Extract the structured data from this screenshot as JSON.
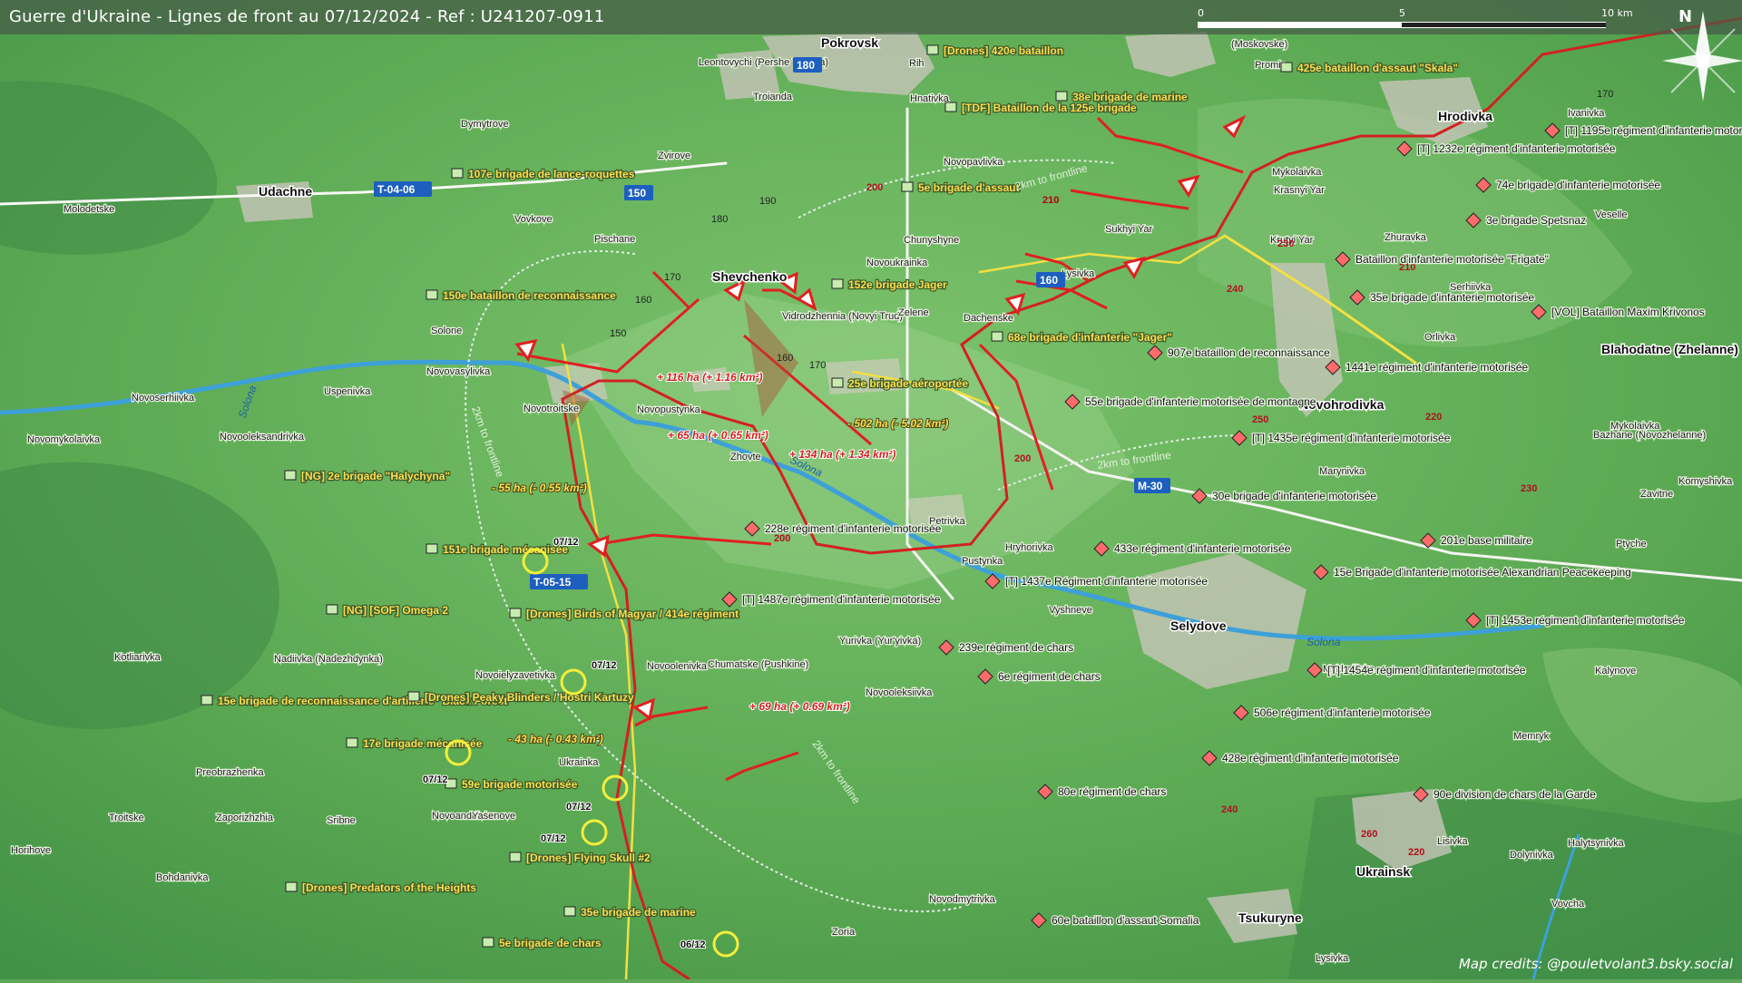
{
  "title": "Guerre d'Ukraine - Lignes de front au 07/12/2024 - Ref : U241207-0911",
  "credits": "Map credits: @pouletvolant3.bsky.social",
  "compass_label": "N",
  "scale": {
    "labels": [
      "0",
      "5",
      "10 km"
    ]
  },
  "colors": {
    "front_line": "#d32020",
    "advance_arrow": "#e02020",
    "unit_text": "#ffde50",
    "enemy_unit": "#ff6b6b",
    "road": "#f4e040"
  },
  "towns": [
    {
      "name": "Pokrovsk"
    },
    {
      "name": "Shevchenko"
    },
    {
      "name": "Udachne"
    },
    {
      "name": "Selydove"
    },
    {
      "name": "Novohrodivka"
    },
    {
      "name": "Hrodivka"
    },
    {
      "name": "Ukrainsk"
    },
    {
      "name": "Tsukuryne"
    },
    {
      "name": "Blahodatne (Zhelanne)"
    }
  ],
  "villages": [
    "Leontovychi (Pershe Travnia)",
    "Troianda",
    "Zvirove",
    "Dymytrove",
    "Molodetske",
    "Pischane",
    "Vovkove",
    "Solone",
    "Novovasylivka",
    "Uspenivka",
    "Novoserhiivka",
    "Novomykolaivka",
    "Novooleksandrivka",
    "Novotroitske",
    "Novopustynka",
    "Zhovte",
    "Vidrodzhennia (Novyi Trud)",
    "Zelene",
    "Dachenske",
    "Novoukrainka",
    "Chunyshyne",
    "Novopavlivka",
    "Hnativka",
    "Rih",
    "Sukhyi Yar",
    "Lysivka",
    "Krutyi Yar",
    "Zhuravka",
    "Mykolaivka",
    "Krasnyi Yar",
    "Promin",
    "(Moskovske)",
    "Ivanivka",
    "Veselle",
    "Serhiivka",
    "Orlivka",
    "Mykolaivka",
    "Bazhane (Novozhelanne)",
    "Zavitne",
    "Komyshivka",
    "Ptyche",
    "Marynivka",
    "Petrivka",
    "Hryhorivka",
    "Vyshneve",
    "Pustynka",
    "Yurivka (Yur'yivka)",
    "Novooleksiivka",
    "Chumatske (Pushkine)",
    "Novoolenivka",
    "Novoielyzavetivka",
    "Nadiivka (Nadezhdynka)",
    "Kotliarivka",
    "Preobrazhenka",
    "Ukrainka",
    "Troitske",
    "Zaporizhzhia",
    "Sribne",
    "Novoandriivka",
    "Yasenove",
    "Horihove",
    "Bohdanivka",
    "Zoria",
    "Novodmytrivka",
    "Mykhailivka",
    "Memryk",
    "Kalynove",
    "Lisivka",
    "Dolynivka",
    "Halytsynivka",
    "Lysivka",
    "Vovcha"
  ],
  "roads": [
    {
      "label": "T-04-06"
    },
    {
      "label": "T-05-15"
    },
    {
      "label": "M-30"
    },
    {
      "label": "180"
    },
    {
      "label": "150"
    },
    {
      "label": "160"
    },
    {
      "label": "170"
    }
  ],
  "elevations": [
    "190",
    "180",
    "170",
    "160",
    "150",
    "160",
    "170",
    "200",
    "210",
    "210",
    "230",
    "240",
    "250",
    "220",
    "230",
    "200",
    "200",
    "240",
    "260",
    "220",
    "210",
    "170"
  ],
  "ukr_units": [
    "107e brigade de lance-roquettes",
    "150e bataillon de reconnaissance",
    "[NG] 2e brigade \"Halychyna\"",
    "151e brigade mécanisée",
    "[NG] [SOF] Omega 2",
    "[Drones] Birds of Magyar / 414e régiment",
    "15e brigade de reconnaissance d'artillerie \"Black Forest\"",
    "[Drones] Peaky Blinders / Hostri Kartuzy",
    "17e brigade mécanisée",
    "59e brigade motorisée",
    "[Drones] Flying Skull #2",
    "[Drones] Predators of the Heights",
    "35e brigade de marine",
    "5e brigade de chars",
    "[Drones] 420e bataillon",
    "[TDF] Bataillon de la 125e brigade",
    "5e brigade d'assaut",
    "152e brigade Jager",
    "25e brigade aéroportée",
    "68e brigade d'infanterie \"Jager\"",
    "38e brigade de marine",
    "425e bataillon d'assaut \"Skala\""
  ],
  "rus_units": [
    "[T] 1232e régiment d'infanterie motorisée",
    "3e brigade Spetsnaz",
    "74e brigade d'infanterie motorisée",
    "[T] 1195e régiment d'infanterie motorisée",
    "Bataillon d'infanterie motorisée \"Frigate\"",
    "35e brigade d'infanterie motorisée",
    "[VOL] Bataillon Maxim Krivonos",
    "907e bataillon de reconnaissance",
    "1441e régiment d'infanterie motorisée",
    "55e brigade d'infanterie motorisée de montagne",
    "[T] 1435e régiment d'infanterie motorisée",
    "30e brigade d'infanterie motorisée",
    "433e régiment d'infanterie motorisée",
    "15e Brigade d'infanterie motorisée Alexandrian Peacekeeping",
    "201e base militaire",
    "[T] 1453e régiment d'infanterie motorisée",
    "228e régiment d'infanterie motorisée",
    "[T] 1487e régiment d'infanterie motorisée",
    "[T] 1437e Régiment d'infanterie motorisée",
    "239e régiment de chars",
    "6e régiment de chars",
    "[T] 1454e régiment d'infanterie motorisée",
    "506e régiment d'infanterie motorisée",
    "428e régiment d'infanterie motorisée",
    "80e régiment de chars",
    "90e division de chars de la Garde",
    "60e bataillon d'assaut Somalia"
  ],
  "area_changes": [
    "+ 116 ha (+ 1.16 km²)",
    "+ 65 ha (+ 0.65 km²)",
    "+ 134 ha (+ 1.34 km²)",
    "- 502 ha (- 5.02 km²)",
    "- 55 ha (- 0.55 km²)",
    "+ 69 ha (+ 0.69 km²)",
    "- 43 ha (- 0.43 km²)"
  ],
  "dates": [
    "07/12",
    "07/12",
    "07/12",
    "07/12",
    "07/12",
    "06/12"
  ],
  "distance_rings": [
    "2km to frontline",
    "2km to frontline",
    "2km to frontline",
    "2km to frontline"
  ],
  "river_names": [
    "Solona",
    "Solona",
    "Solona"
  ]
}
